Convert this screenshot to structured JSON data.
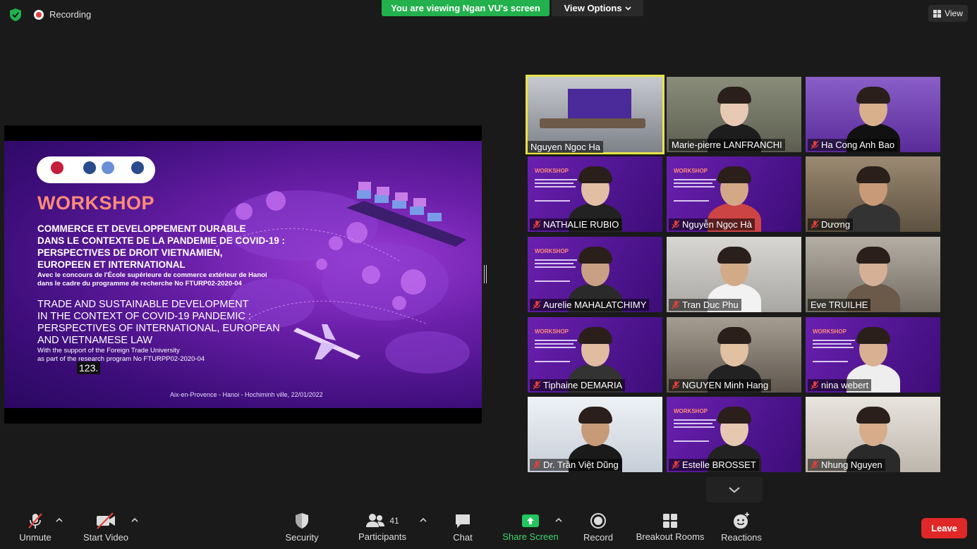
{
  "topbar": {
    "recording_label": "Recording",
    "viewing_banner": "You are viewing Ngan VU's screen",
    "view_options_label": "View Options",
    "view_label": "View"
  },
  "slide": {
    "title": "WORKSHOP",
    "fr_lines": [
      "COMMERCE ET DEVELOPPEMENT DURABLE",
      "DANS LE CONTEXTE DE LA PANDEMIE DE COVID-19 :",
      "PERSPECTIVES DE DROIT VIETNAMIEN,",
      "EUROPEEN ET INTERNATIONAL"
    ],
    "fr_sub_lines": [
      "Avec le concours de l'École supérieure de commerce extérieur de Hanoi",
      "dans le cadre du programme de recherche No FTURP02-2020-04"
    ],
    "en_lines": [
      "TRADE AND SUSTAINABLE DEVELOPMENT",
      "IN THE CONTEXT OF COVID-19 PANDEMIC :",
      "PERSPECTIVES OF INTERNATIONAL, EUROPEAN",
      "AND VIETNAMESE LAW"
    ],
    "en_sub_lines": [
      "With the support of the Foreign Trade University",
      "as part of the research program No FTURPP02-2020-04"
    ],
    "slide_number": "123.",
    "footer": "Aix-en-Provence - Hanoi - Hochiminh ville, 22/01/2022"
  },
  "participants_tiles": [
    {
      "name": "Nguyen Ngoc Ha",
      "muted": false
    },
    {
      "name": "Marie-pierre LANFRANCHI",
      "muted": false
    },
    {
      "name": "Ha Cong Anh Bao",
      "muted": true
    },
    {
      "name": "NATHALIE RUBIO",
      "muted": true
    },
    {
      "name": "Nguyễn Ngọc Hà",
      "muted": true
    },
    {
      "name": "Dương",
      "muted": true
    },
    {
      "name": "Aurelie MAHALATCHIMY",
      "muted": true
    },
    {
      "name": "Tran Duc Phu",
      "muted": true
    },
    {
      "name": "Eve TRUILHE",
      "muted": false
    },
    {
      "name": "Tiphaine DEMARIA",
      "muted": true
    },
    {
      "name": "NGUYEN Minh Hang",
      "muted": true
    },
    {
      "name": "nina webert",
      "muted": true
    },
    {
      "name": "Dr. Trần Việt Dũng",
      "muted": true
    },
    {
      "name": "Estelle BROSSET",
      "muted": true
    },
    {
      "name": "Nhung Nguyen",
      "muted": true
    }
  ],
  "toolbar": {
    "unmute": "Unmute",
    "start_video": "Start Video",
    "security": "Security",
    "participants": "Participants",
    "participants_count": "41",
    "chat": "Chat",
    "share_screen": "Share Screen",
    "record": "Record",
    "breakout_rooms": "Breakout Rooms",
    "reactions": "Reactions",
    "leave": "Leave"
  },
  "colors": {
    "viewing_banner": "#22b14c",
    "share_screen": "#22c55e",
    "leave": "#e02828",
    "active_speaker": "#e6e34a",
    "mute_red": "#e0413a"
  }
}
